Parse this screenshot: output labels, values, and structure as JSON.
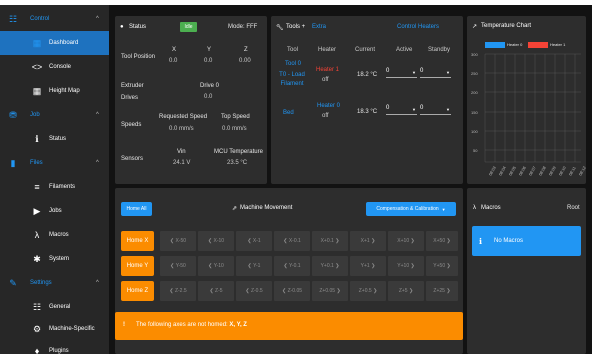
{
  "sidebar": {
    "groups": [
      {
        "name": "control",
        "label": "Control",
        "icon": "control-icon"
      },
      {
        "name": "job",
        "label": "Job",
        "icon": "job-icon"
      },
      {
        "name": "files",
        "label": "Files",
        "icon": "files-icon"
      },
      {
        "name": "settings",
        "label": "Settings",
        "icon": "settings-icon"
      }
    ],
    "items": [
      {
        "label": "Dashboard",
        "icon": "dashboard-icon",
        "glyph": "▦",
        "active": true
      },
      {
        "label": "Console",
        "icon": "console-icon",
        "glyph": "<>"
      },
      {
        "label": "Height Map",
        "icon": "height-map-icon",
        "glyph": "▦"
      },
      {
        "label": "Status",
        "icon": "info-icon",
        "glyph": "ℹ"
      },
      {
        "label": "Filaments",
        "icon": "filaments-icon",
        "glyph": "≡"
      },
      {
        "label": "Jobs",
        "icon": "play-icon",
        "glyph": "▶"
      },
      {
        "label": "Macros",
        "icon": "macros-icon",
        "glyph": "λ"
      },
      {
        "label": "System",
        "icon": "gear-icon",
        "glyph": "✱"
      },
      {
        "label": "General",
        "icon": "sliders-icon",
        "glyph": "☷"
      },
      {
        "label": "Machine-Specific",
        "icon": "machine-icon",
        "glyph": "⚙"
      },
      {
        "label": "Plugins",
        "icon": "plugins-icon",
        "glyph": "♦"
      }
    ]
  },
  "status": {
    "title": "Status",
    "state": "Idle",
    "mode": "Mode: FFF",
    "tool_position_label": "Tool Position",
    "axes": [
      "X",
      "Y",
      "Z"
    ],
    "axis_values": [
      "0.0",
      "0.0",
      "0.00"
    ],
    "extruder_label": "Extruder",
    "drives_label": "Drives",
    "drive_header": "Drive 0",
    "drive_value": "0.0",
    "speeds_label": "Speeds",
    "requested_speed_label": "Requested Speed",
    "requested_speed_value": "0.0 mm/s",
    "top_speed_label": "Top Speed",
    "top_speed_value": "0.0 mm/s",
    "sensors_label": "Sensors",
    "vin_label": "Vin",
    "vin_value": "24.1 V",
    "mcu_label": "MCU Temperature",
    "mcu_value": "23.5 °C"
  },
  "tools": {
    "title": "Tools +",
    "extra_tab": "Extra",
    "control_heaters": "Control Heaters",
    "headers": [
      "Tool",
      "Heater",
      "Current",
      "Active",
      "Standby"
    ],
    "rows": [
      {
        "tool": "Tool 0",
        "tool_sub": "T0 - Load Filament",
        "heater": "Heater 1",
        "heater_state": "off",
        "current": "18.2 °C",
        "active": "0",
        "standby": "0"
      },
      {
        "tool": "Bed",
        "tool_sub": "",
        "heater": "Heater 0",
        "heater_state": "off",
        "current": "18.3 °C",
        "active": "0",
        "standby": "0"
      }
    ]
  },
  "temp_chart": {
    "title": "Temperature Chart",
    "legend": [
      {
        "name": "Heater 0",
        "color": "#2196f3"
      },
      {
        "name": "Heater 1",
        "color": "#f44336"
      }
    ],
    "y_ticks": [
      "300",
      "250",
      "200",
      "150",
      "100",
      "50"
    ],
    "x_ticks": [
      "08:03",
      "08:04",
      "08:05",
      "08:06",
      "08:07",
      "08:08",
      "08:09",
      "08:10",
      "08:11",
      "08:12"
    ]
  },
  "movement": {
    "home_all": "Home All",
    "title": "Machine Movement",
    "compensation": "Compensation & Calibration",
    "rows": [
      {
        "home": "Home X",
        "buttons": [
          "X-50",
          "X-10",
          "X-1",
          "X-0.1",
          "X+0.1",
          "X+1",
          "X+10",
          "X+50"
        ]
      },
      {
        "home": "Home Y",
        "buttons": [
          "Y-50",
          "Y-10",
          "Y-1",
          "Y-0.1",
          "Y+0.1",
          "Y+1",
          "Y+10",
          "Y+50"
        ]
      },
      {
        "home": "Home Z",
        "buttons": [
          "Z-2.5",
          "Z-5",
          "Z-0.5",
          "Z-0.05",
          "Z+0.05",
          "Z+0.5",
          "Z+5",
          "Z+25"
        ]
      }
    ],
    "warning_prefix": "The following axes are not homed:",
    "warning_axes": "X, Y, Z"
  },
  "macros": {
    "title": "Macros",
    "root": "Root",
    "empty": "No Macros"
  },
  "colors": {
    "accent": "#2196f3",
    "warning": "#fb8c00",
    "idle": "#4caf50",
    "heater": "#f44336"
  }
}
